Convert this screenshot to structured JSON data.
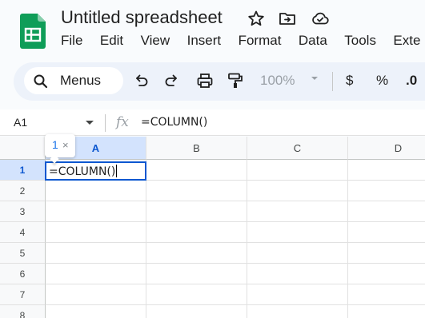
{
  "app": {
    "title": "Untitled spreadsheet",
    "brand_color": "#0f9d58"
  },
  "menu": [
    "File",
    "Edit",
    "View",
    "Insert",
    "Format",
    "Data",
    "Tools",
    "Exte"
  ],
  "toolbar": {
    "search_label": "Menus",
    "zoom": "100%",
    "currency": "$",
    "percent": "%",
    "decimal_decrease": ".0"
  },
  "formula_bar": {
    "name_box": "A1",
    "fx": "fx",
    "formula": "=COLUMN()"
  },
  "grid": {
    "columns": [
      "A",
      "B",
      "C",
      "D"
    ],
    "rows": [
      "1",
      "2",
      "3",
      "4",
      "5",
      "6",
      "7",
      "8"
    ],
    "active_cell_value": "=COLUMN()",
    "selected_column": "A",
    "selected_row": "1",
    "selection_color": "#0b57d0"
  },
  "chip": {
    "count": "1",
    "close": "×"
  }
}
